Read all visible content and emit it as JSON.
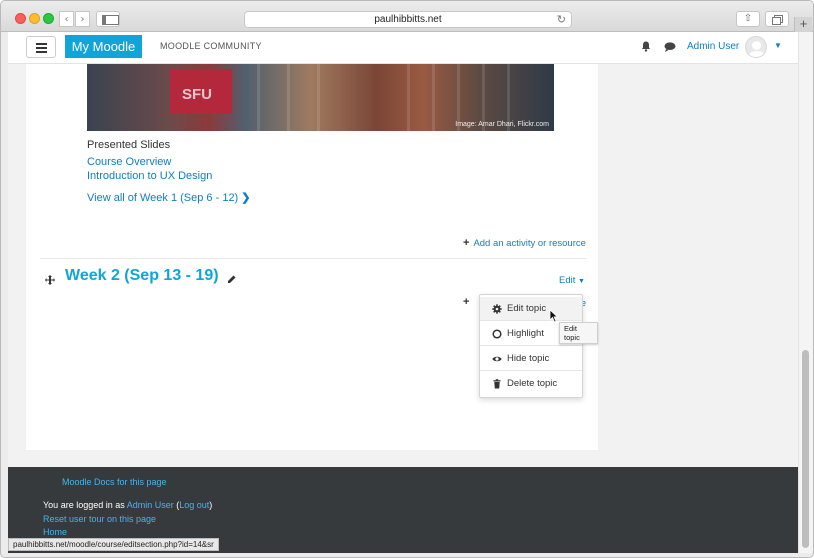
{
  "browser": {
    "url": "paulhibbitts.net",
    "status_url": "paulhibbitts.net/moodle/course/editsection.php?id=14&sr"
  },
  "navbar": {
    "brand": "My Moodle",
    "community": "MOODLE COMMUNITY",
    "user_name": "Admin User"
  },
  "section1": {
    "image_credit": "Image: Amar Dhari, Flickr.com",
    "image_sign": "SFU",
    "presented_label": "Presented Slides",
    "links": [
      "Course Overview",
      "Introduction to UX Design"
    ],
    "view_all": "View all of Week 1 (Sep 6 - 12)",
    "add_activity": "Add an activity or resource"
  },
  "section2": {
    "title": "Week 2 (Sep 13 - 19)",
    "edit_label": "Edit",
    "add_tail": "e"
  },
  "edit_menu": {
    "items": [
      "Edit topic",
      "Highlight",
      "Hide topic",
      "Delete topic"
    ],
    "tooltip": "Edit topic"
  },
  "footer": {
    "docs_link": "Moodle Docs for this page",
    "logged_in_prefix": "You are logged in as",
    "logged_in_user": "Admin User",
    "logout": "Log out",
    "reset_tour": "Reset user tour on this page",
    "home": "Home"
  },
  "colors": {
    "brand": "#0fa5d9",
    "link": "#0f7fc0",
    "footer_bg": "#373a3c"
  }
}
